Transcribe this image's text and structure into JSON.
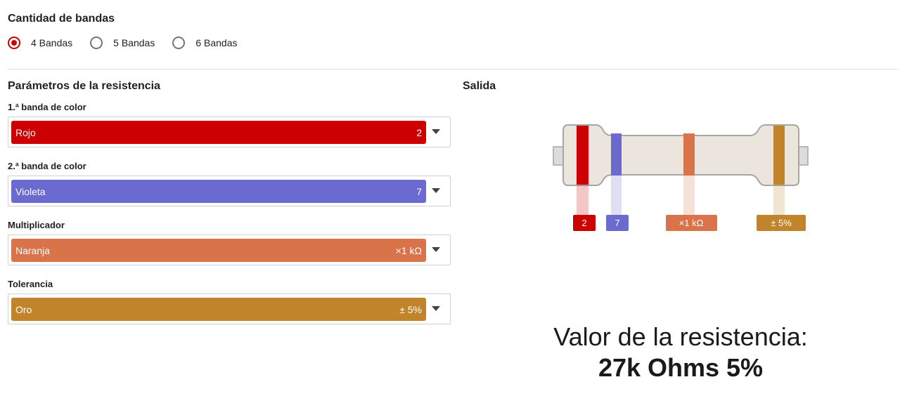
{
  "band_count": {
    "title": "Cantidad de bandas",
    "options": [
      {
        "label": "4 Bandas",
        "checked": true
      },
      {
        "label": "5 Bandas",
        "checked": false
      },
      {
        "label": "6 Bandas",
        "checked": false
      }
    ]
  },
  "params": {
    "title": "Parámetros de la resistencia",
    "fields": [
      {
        "label": "1.ª banda de color",
        "color_name": "Rojo",
        "value": "2",
        "color": "#cc0000"
      },
      {
        "label": "2.ª banda de color",
        "color_name": "Violeta",
        "value": "7",
        "color": "#6a6ad0"
      },
      {
        "label": "Multiplicador",
        "color_name": "Naranja",
        "value": "×1 kΩ",
        "color": "#d9734a"
      },
      {
        "label": "Tolerancia",
        "color_name": "Oro",
        "value": "± 5%",
        "color": "#c1842a"
      }
    ]
  },
  "output": {
    "title": "Salida",
    "band_tags": [
      "2",
      "7",
      "×1 kΩ",
      "± 5%"
    ],
    "result_title": "Valor de la resistencia:",
    "result_value": "27k Ohms 5%"
  },
  "colors": {
    "accent": "#cc0000",
    "body": "#ebe5dd",
    "body_stroke": "#a6a6a6",
    "lead": "#dcdcdc"
  }
}
